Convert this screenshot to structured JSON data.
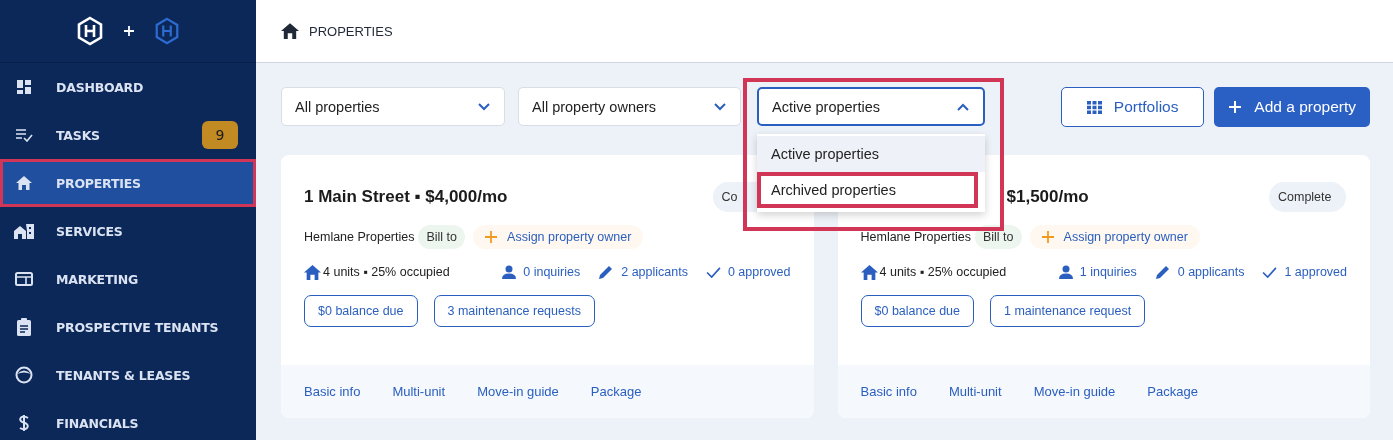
{
  "sidebar": {
    "items": [
      {
        "label": "DASHBOARD",
        "selected": false,
        "highlighted": false
      },
      {
        "label": "TASKS",
        "selected": false,
        "highlighted": false,
        "badge": "9"
      },
      {
        "label": "PROPERTIES",
        "selected": true,
        "highlighted": true
      },
      {
        "label": "SERVICES",
        "selected": false,
        "highlighted": false
      },
      {
        "label": "MARKETING",
        "selected": false,
        "highlighted": false
      },
      {
        "label": "PROSPECTIVE TENANTS",
        "selected": false,
        "highlighted": false
      },
      {
        "label": "TENANTS & LEASES",
        "selected": false,
        "highlighted": false
      },
      {
        "label": "FINANCIALS",
        "selected": false,
        "highlighted": false
      }
    ]
  },
  "header": {
    "title": "PROPERTIES"
  },
  "filters": [
    {
      "value": "All properties",
      "expanded": false,
      "highlighted": false
    },
    {
      "value": "All property owners",
      "expanded": false,
      "highlighted": false
    },
    {
      "value": "Active properties",
      "expanded": true,
      "highlighted": true,
      "options": [
        {
          "label": "Active properties",
          "selected": true,
          "highlighted": false
        },
        {
          "label": "Archived properties",
          "selected": false,
          "highlighted": true
        }
      ]
    }
  ],
  "buttons": [
    {
      "label": "Portfolios",
      "kind": "outline"
    },
    {
      "label": "Add a property",
      "kind": "primary"
    }
  ],
  "cards": [
    {
      "title": "1 Main Street ▪ $4,000/mo",
      "title_covered": false,
      "status": "Co",
      "owner": "Hemlane Properties",
      "bill_tag": "Bill to",
      "assign": "Assign property owner",
      "units": "4 units ▪ 25% occupied",
      "inquiries": "0 inquiries",
      "applicants": "2 applicants",
      "approved": "0 approved",
      "chips": [
        "$0 balance due",
        "3 maintenance requests"
      ],
      "links": [
        "Basic info",
        "Multi-unit",
        "Move-in guide",
        "Package"
      ]
    },
    {
      "title": "$1,500/mo",
      "title_covered": true,
      "status": "Complete",
      "owner": "Hemlane Properties",
      "bill_tag": "Bill to",
      "assign": "Assign property owner",
      "units": "4 units ▪ 25% occupied",
      "inquiries": "1 inquiries",
      "applicants": "0 applicants",
      "approved": "1 approved",
      "chips": [
        "$0 balance due",
        "1 maintenance request"
      ],
      "links": [
        "Basic info",
        "Multi-unit",
        "Move-in guide",
        "Package"
      ]
    }
  ]
}
